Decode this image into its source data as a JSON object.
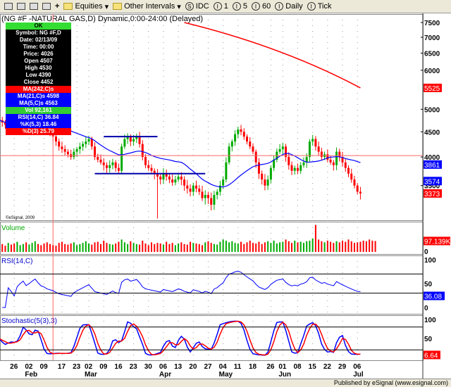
{
  "toolbar": {
    "items": [
      "Equities",
      "Other Intervals",
      "IDC",
      "1",
      "5",
      "60",
      "Daily",
      "Tick"
    ]
  },
  "title": "(NG #F -NATURAL GAS,D) Dynamic,0:00-24:00 (Delayed)",
  "copyright": "©eSignal, 2009",
  "databox": {
    "ok": "OK",
    "symbol": "Symbol: NG #F,D",
    "date": "Date: 02/13/09",
    "time": "Time: 00:00",
    "price": "Price: 4026",
    "open": "Open 4507",
    "high": "High 4530",
    "low": "Low 4390",
    "close": "Close 4452",
    "ma242": "MA(242,C)s",
    "ma21": "MA(21,C)s 4598",
    "ma5": "MA(5,C)s 4563",
    "vol": "Vol 92,161",
    "rsi": "RSI(14,C) 36.84",
    "k": "%K(5,3) 18.46",
    "d": "%D(3) 25.79"
  },
  "panels": {
    "volume": "Volume",
    "rsi": "RSI(14,C)",
    "stoch": "Stochastic(5(3),3)"
  },
  "colors": {
    "up": "#00aa00",
    "down": "#ff0000",
    "ma": "#0000ff",
    "ma242": "#ff0000"
  },
  "chart_data": {
    "type": "candlestick",
    "price_axis": {
      "ticks": [
        7500,
        7000,
        6500,
        6000,
        5000,
        4500,
        4000,
        3500
      ],
      "range": [
        3000,
        7600
      ]
    },
    "price_labels": [
      {
        "value": 5525,
        "text": "5525",
        "color": "#ff0000"
      },
      {
        "value": 3861,
        "text": "3861",
        "color": "#0000ff"
      },
      {
        "value": 3574,
        "text": "3574",
        "color": "#0000ff"
      },
      {
        "value": 3373,
        "text": "3373",
        "color": "#ff0000"
      }
    ],
    "ma242": {
      "start_day": 62,
      "start": 7500,
      "end": 5525
    },
    "hlines": [
      {
        "value": 4400,
        "from_day": 35,
        "to_day": 53
      },
      {
        "value": 3700,
        "from_day": 32,
        "to_day": 69
      }
    ],
    "cursor": {
      "day": 18,
      "price": 4026
    },
    "closes": [
      4750,
      4700,
      4650,
      4720,
      4680,
      4600,
      4700,
      4750,
      4800,
      4700,
      4750,
      4820,
      4900,
      4780,
      4650,
      4600,
      4500,
      4450,
      4400,
      4300,
      4200,
      4150,
      4100,
      4050,
      4000,
      4100,
      4150,
      4200,
      4250,
      4300,
      4350,
      4200,
      4000,
      3950,
      3900,
      3850,
      3800,
      3850,
      3900,
      3800,
      3750,
      4200,
      4350,
      4400,
      4300,
      4350,
      4400,
      4250,
      4000,
      3850,
      3800,
      3750,
      3700,
      3650,
      3600,
      3700,
      3650,
      3600,
      3550,
      3600,
      3650,
      3600,
      3500,
      3450,
      3400,
      3500,
      3450,
      3400,
      3300,
      3350,
      3300,
      3200,
      3350,
      3400,
      3500,
      3600,
      3900,
      4200,
      4300,
      4450,
      4550,
      4500,
      4400,
      4300,
      4200,
      4100,
      3900,
      3700,
      3600,
      3500,
      3600,
      3800,
      3950,
      4100,
      4150,
      4200,
      4000,
      3850,
      3750,
      3800,
      3750,
      3850,
      3900,
      4000,
      4300,
      4350,
      4200,
      4100,
      4000,
      4050,
      3950,
      3900,
      3850,
      4100,
      4000,
      3900,
      3800,
      3700,
      3600,
      3500,
      3400,
      3373
    ],
    "volume_k": [
      60,
      70,
      55,
      80,
      65,
      75,
      90,
      60,
      70,
      85,
      65,
      80,
      95,
      70,
      60,
      75,
      85,
      70,
      60,
      55,
      80,
      90,
      70,
      65,
      75,
      85,
      60,
      70,
      80,
      95,
      75,
      65,
      85,
      90,
      70,
      100,
      80,
      70,
      65,
      75,
      90,
      110,
      85,
      70,
      95,
      80,
      70,
      65,
      100,
      75,
      60,
      85,
      70,
      80,
      75,
      65,
      90,
      70,
      80,
      60,
      75,
      85,
      70,
      65,
      90,
      80,
      75,
      70,
      60,
      85,
      95,
      80,
      70,
      65,
      90,
      110,
      100,
      85,
      95,
      80,
      75,
      90,
      70,
      85,
      100,
      80,
      75,
      90,
      70,
      85,
      95,
      80,
      100,
      75,
      85,
      90,
      110,
      95,
      80,
      100,
      85,
      90,
      80,
      95,
      100,
      120,
      240,
      110,
      95,
      85,
      100,
      90,
      80,
      95,
      85,
      100,
      90,
      110,
      95,
      80,
      85,
      90,
      100,
      95,
      110,
      100,
      97
    ],
    "volume_labels": [
      "97.139K",
      "0"
    ],
    "rsi_axis": [
      "100",
      "50",
      "36.08",
      "0"
    ],
    "stoch_axis": [
      "100",
      "50",
      "6.64"
    ],
    "x_ticks": [
      "26",
      "02",
      "09",
      "17",
      "23",
      "02",
      "09",
      "16",
      "23",
      "30",
      "06",
      "13",
      "20",
      "27",
      "04",
      "11",
      "18",
      "26",
      "01",
      "08",
      "15",
      "22",
      "29",
      "06"
    ],
    "x_months": [
      "Feb",
      "Mar",
      "Apr",
      "May",
      "Jun",
      "Jul"
    ]
  },
  "footer": "Published by eSignal (www.esignal.com)"
}
